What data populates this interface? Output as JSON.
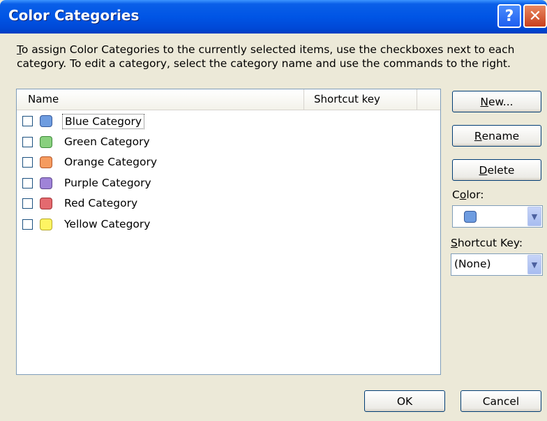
{
  "window": {
    "title": "Color Categories",
    "help_glyph": "?",
    "close_glyph": "✕"
  },
  "instructions": {
    "line1_u": "T",
    "line1_rest": "o assign Color Categories to the currently selected items, use the checkboxes next to each",
    "line2": "category.  To edit a category, select the category name and use the commands to the right."
  },
  "list": {
    "columns": {
      "name": "Name",
      "shortcut": "Shortcut key"
    },
    "items": [
      {
        "label": "Blue Category",
        "color": "#6e9ce0",
        "border": "#35599a",
        "checked": false,
        "shortcut": ""
      },
      {
        "label": "Green Category",
        "color": "#89d07e",
        "border": "#3d8a3a",
        "checked": false,
        "shortcut": ""
      },
      {
        "label": "Orange Category",
        "color": "#f59b5f",
        "border": "#b5582a",
        "checked": false,
        "shortcut": ""
      },
      {
        "label": "Purple Category",
        "color": "#9f83d8",
        "border": "#5f478e",
        "checked": false,
        "shortcut": ""
      },
      {
        "label": "Red Category",
        "color": "#e46a6f",
        "border": "#a23236",
        "checked": false,
        "shortcut": ""
      },
      {
        "label": "Yellow Category",
        "color": "#fef463",
        "border": "#b7a928",
        "checked": false,
        "shortcut": ""
      }
    ],
    "selected_index": 0
  },
  "buttons": {
    "new": {
      "u": "N",
      "rest": "ew..."
    },
    "rename": {
      "u": "R",
      "rest": "ename"
    },
    "delete": {
      "u": "D",
      "rest": "elete"
    },
    "ok": "OK",
    "cancel": "Cancel"
  },
  "color_field": {
    "label_pre": "C",
    "label_u": "o",
    "label_post": "lor:",
    "selected_color": "#6e9ce0",
    "selected_border": "#35599a"
  },
  "shortcut_field": {
    "label_u": "S",
    "label_rest": "hortcut Key:",
    "value": "(None)"
  }
}
